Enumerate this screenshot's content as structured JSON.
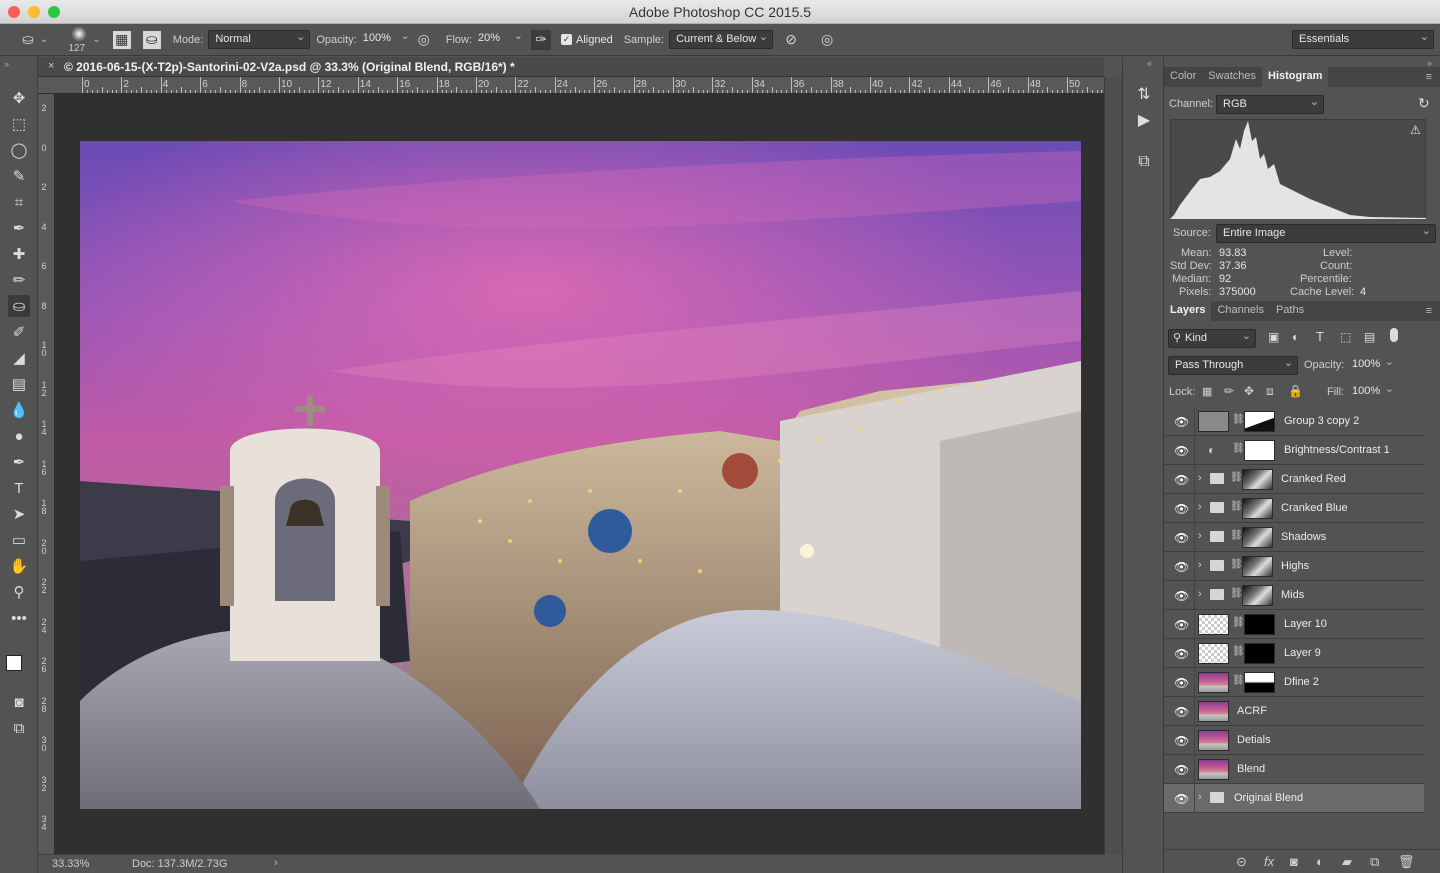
{
  "window": {
    "title": "Adobe Photoshop CC 2015.5"
  },
  "options_bar": {
    "brush_size": "127",
    "mode_label": "Mode:",
    "mode_value": "Normal",
    "opacity_label": "Opacity:",
    "opacity_value": "100%",
    "flow_label": "Flow:",
    "flow_value": "20%",
    "aligned_label": "Aligned",
    "aligned_checked": true,
    "sample_label": "Sample:",
    "sample_value": "Current & Below",
    "workspace_value": "Essentials"
  },
  "document": {
    "tab_close": "×",
    "tab_title": "© 2016-06-15-(X-T2p)-Santorini-02-V2a.psd @ 33.3% (Original Blend, RGB/16*) *",
    "ruler_h_labels": [
      "0",
      "2",
      "4",
      "6",
      "8",
      "10",
      "12",
      "14",
      "16",
      "18",
      "20",
      "22",
      "24",
      "26",
      "28",
      "30",
      "32",
      "34",
      "36",
      "38",
      "40",
      "42",
      "44",
      "46",
      "48",
      "50"
    ],
    "ruler_v_labels": [
      "2",
      "0",
      "2",
      "4",
      "6",
      "8",
      "10",
      "12",
      "14",
      "16",
      "18",
      "20",
      "22",
      "24",
      "26",
      "28",
      "30",
      "32",
      "34"
    ],
    "zoom": "33.33%",
    "doc_info": "Doc: 137.3M/2.73G"
  },
  "histogram_panel": {
    "tabs": [
      "Color",
      "Swatches",
      "Histogram"
    ],
    "active_tab": "Histogram",
    "channel_label": "Channel:",
    "channel_value": "RGB",
    "source_label": "Source:",
    "source_value": "Entire Image",
    "stats": {
      "mean_label": "Mean:",
      "mean": "93.83",
      "stddev_label": "Std Dev:",
      "stddev": "37.36",
      "median_label": "Median:",
      "median": "92",
      "pixels_label": "Pixels:",
      "pixels": "375000",
      "level_label": "Level:",
      "level": "",
      "count_label": "Count:",
      "count": "",
      "percentile_label": "Percentile:",
      "percentile": "",
      "cache_label": "Cache Level:",
      "cache": "4"
    }
  },
  "layers_panel": {
    "tabs": [
      "Layers",
      "Channels",
      "Paths"
    ],
    "active_tab": "Layers",
    "filter_value": "Kind",
    "blend_value": "Pass Through",
    "opacity_label": "Opacity:",
    "opacity_value": "100%",
    "lock_label": "Lock:",
    "fill_label": "Fill:",
    "fill_value": "100%",
    "layers": [
      {
        "name": "Group 3 copy 2",
        "kind": "mask"
      },
      {
        "name": "Brightness/Contrast 1",
        "kind": "adjust"
      },
      {
        "name": "Cranked Red",
        "kind": "group"
      },
      {
        "name": "Cranked Blue",
        "kind": "group"
      },
      {
        "name": "Shadows",
        "kind": "group"
      },
      {
        "name": "Highs",
        "kind": "group"
      },
      {
        "name": "Mids",
        "kind": "group"
      },
      {
        "name": "Layer 10",
        "kind": "pixel"
      },
      {
        "name": "Layer 9",
        "kind": "pixel"
      },
      {
        "name": "Dfine 2",
        "kind": "masked-photo"
      },
      {
        "name": "ACRF",
        "kind": "photo"
      },
      {
        "name": "Detials",
        "kind": "photo"
      },
      {
        "name": "Blend",
        "kind": "photo"
      },
      {
        "name": "Original Blend",
        "kind": "folder-selected"
      }
    ]
  },
  "colors": {
    "ui_bg": "#535353",
    "canvas_bg": "#303030",
    "selected_layer": "#6a6a6a",
    "close_dot": "#fc5f57",
    "min_dot": "#fdbc2e",
    "max_dot": "#28c840"
  }
}
